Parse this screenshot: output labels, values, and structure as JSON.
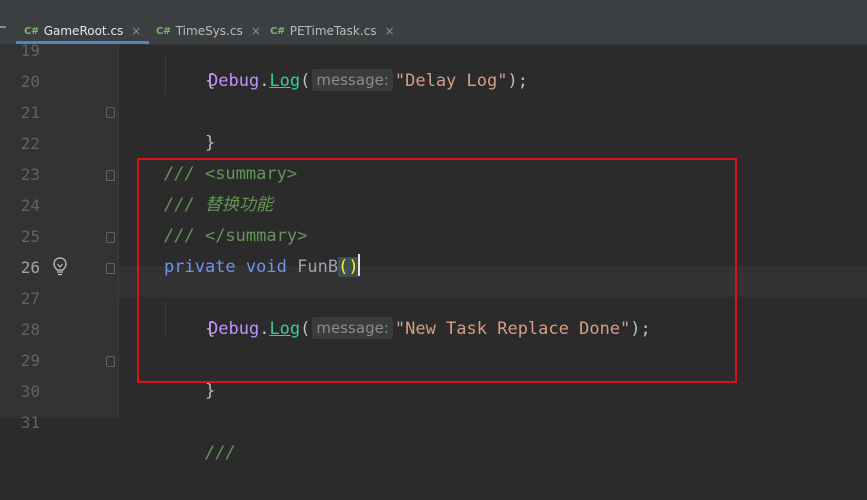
{
  "tabs": [
    {
      "icon": "C#",
      "label": "GameRoot.cs",
      "active": true
    },
    {
      "icon": "C#",
      "label": "TimeSys.cs",
      "active": false
    },
    {
      "icon": "C#",
      "label": "PETimeTask.cs",
      "active": false
    }
  ],
  "close_glyph": "×",
  "line_numbers": [
    "19",
    "20",
    "21",
    "22",
    "23",
    "24",
    "25",
    "26",
    "27",
    "28",
    "29",
    "30",
    "31"
  ],
  "code": {
    "l19_brace": "{",
    "l20_class": "Debug",
    "l20_dot": ".",
    "l20_method": "Log",
    "l20_open": "(",
    "l20_hint": "message:",
    "l20_string": "\"Delay Log\"",
    "l20_close": ");",
    "l21_brace": "}",
    "l23_slashes": "/// ",
    "l23_tag": "<summary>",
    "l24_slashes": "/// ",
    "l24_text": "替换功能",
    "l25_slashes": "/// ",
    "l25_tag": "</summary>",
    "l26_private": "private",
    "l26_void": "void",
    "l26_name": "FunB",
    "l26_paren_open": "(",
    "l26_paren_close": ")",
    "l27_brace": "{",
    "l28_class": "Debug",
    "l28_dot": ".",
    "l28_method": "Log",
    "l28_open": "(",
    "l28_hint": "message:",
    "l28_string": "\"New Task Replace Done\"",
    "l28_close": ");",
    "l29_brace": "}",
    "l31_slashes": "///"
  },
  "colors": {
    "background": "#2b2b2b",
    "gutter": "#313335",
    "highlight_box": "#d4161b",
    "keyword": "#6c95eb",
    "comment": "#629755",
    "string": "#d69d85"
  }
}
